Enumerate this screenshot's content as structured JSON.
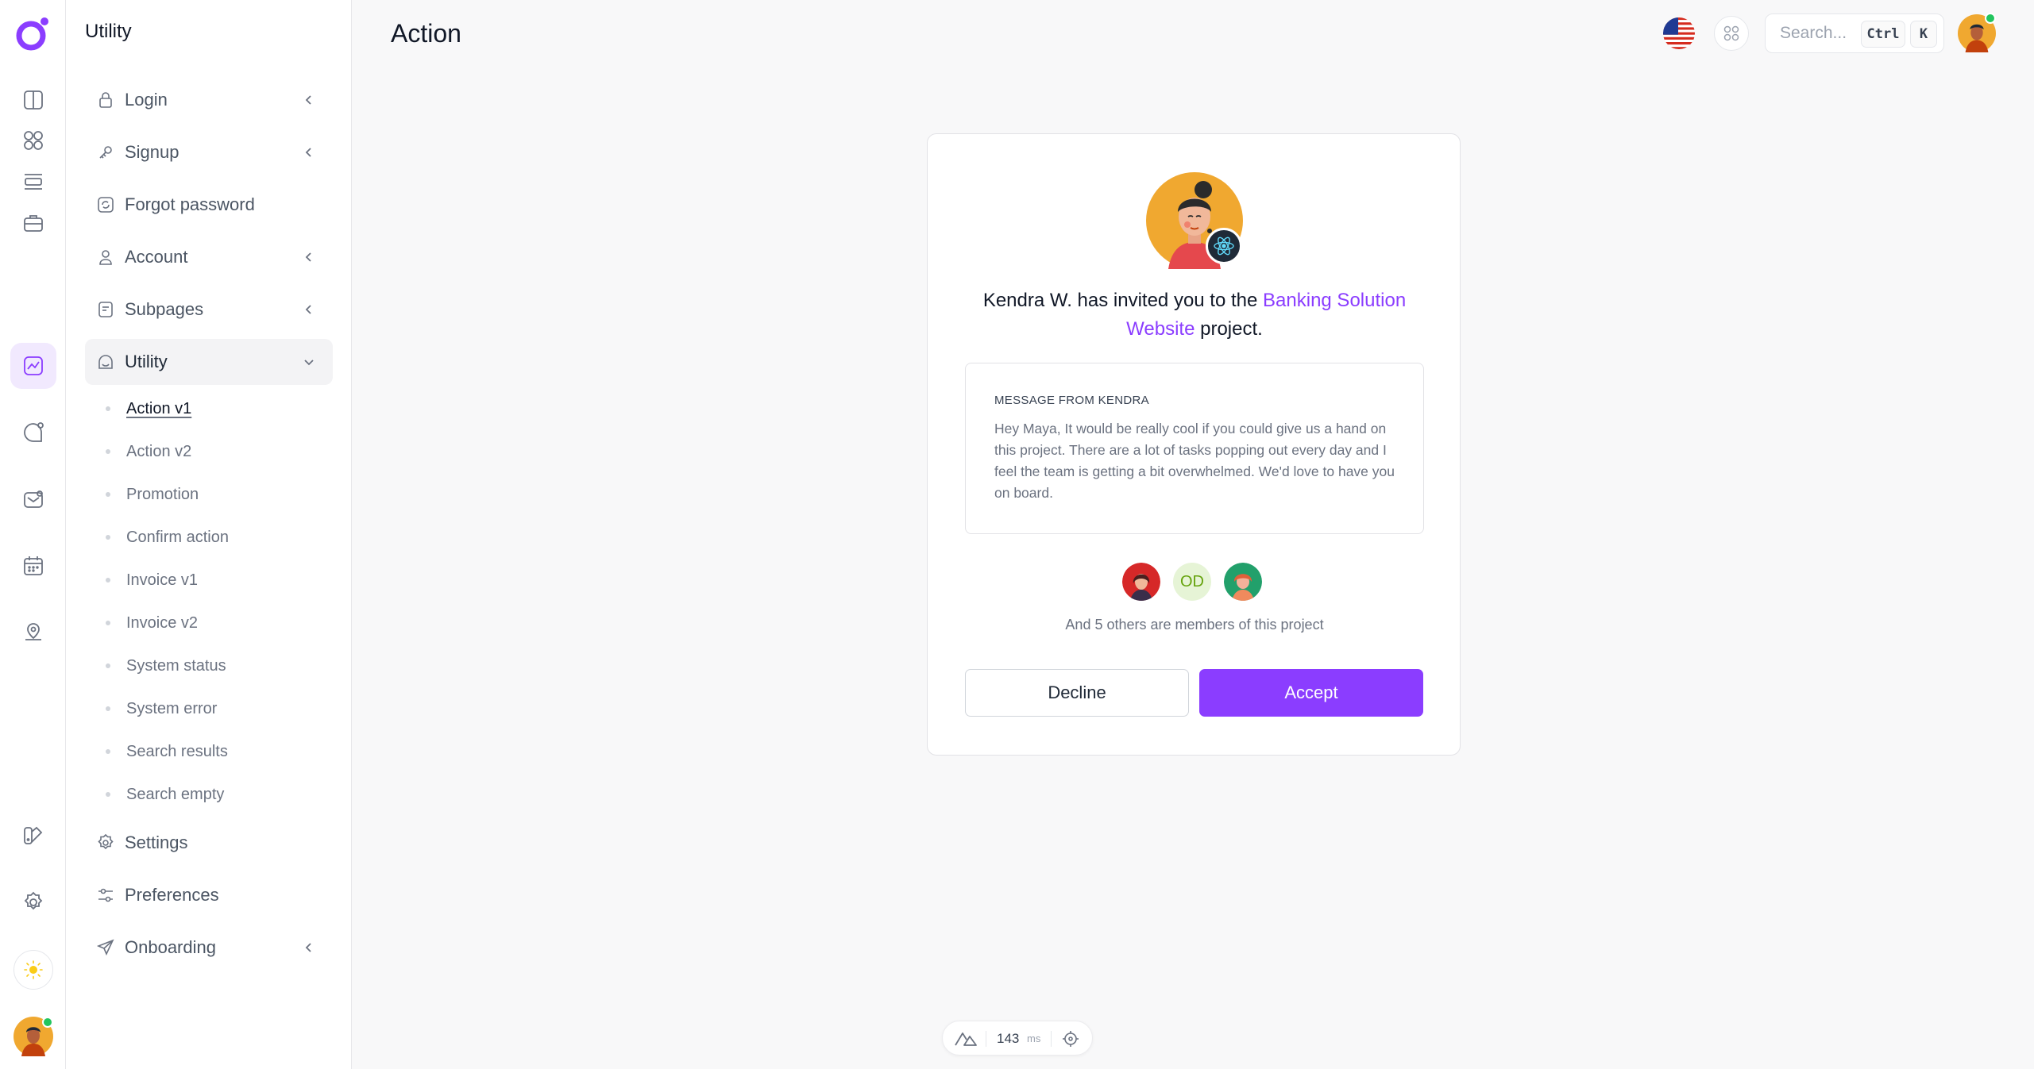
{
  "rail": {
    "icons": [
      "logo-icon",
      "sidebar-panel-icon",
      "dashboard-grid-icon",
      "layers-icon",
      "briefcase-icon",
      "chart-icon",
      "chat-bubble-icon",
      "mail-icon",
      "calendar-icon",
      "map-pin-icon",
      "brush-icon",
      "settings-icon",
      "sun-icon"
    ],
    "active": "chart-icon"
  },
  "sidebar": {
    "title": "Utility",
    "items": [
      {
        "label": "Login",
        "icon": "lock-icon",
        "chevron": "left"
      },
      {
        "label": "Signup",
        "icon": "key-icon",
        "chevron": "left"
      },
      {
        "label": "Forgot password",
        "icon": "refresh-icon",
        "chevron": ""
      },
      {
        "label": "Account",
        "icon": "user-icon",
        "chevron": "left"
      },
      {
        "label": "Subpages",
        "icon": "page-icon",
        "chevron": "left"
      },
      {
        "label": "Utility",
        "icon": "inbox-icon",
        "chevron": "down"
      },
      {
        "label": "Settings",
        "icon": "gear-icon",
        "chevron": ""
      },
      {
        "label": "Preferences",
        "icon": "sliders-icon",
        "chevron": ""
      },
      {
        "label": "Onboarding",
        "icon": "send-icon",
        "chevron": "left"
      }
    ],
    "subitems": [
      "Action v1",
      "Action v2",
      "Promotion",
      "Confirm action",
      "Invoice v1",
      "Invoice v2",
      "System status",
      "System error",
      "Search results",
      "Search empty"
    ],
    "current_subitem": "Action v1"
  },
  "header": {
    "title": "Action",
    "search_placeholder": "Search...",
    "kbd_ctrl": "Ctrl",
    "kbd_k": "K"
  },
  "card": {
    "invite_prefix": "Kendra W. has invited you to the ",
    "project_name": "Banking Solution Website",
    "invite_suffix": " project.",
    "message_label": "MESSAGE FROM KENDRA",
    "message_body": "Hey Maya, It would be really cool if you could give us a hand on this project. There are a lot of tasks popping out every day and I feel the team is getting a bit overwhelmed. We'd love to have you on board.",
    "member_initials": "OD",
    "members_note": "And 5 others are members of this project",
    "decline_label": "Decline",
    "accept_label": "Accept"
  },
  "perf": {
    "value": "143",
    "unit": "ms"
  },
  "colors": {
    "accent": "#8b3dff",
    "accent_soft": "#f1e9fe",
    "online": "#22c55e"
  }
}
